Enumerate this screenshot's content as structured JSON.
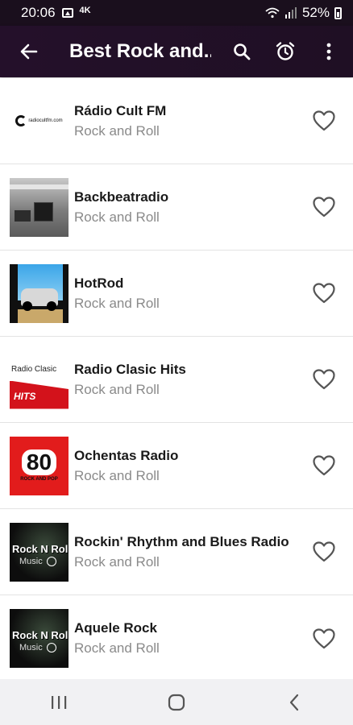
{
  "status_bar": {
    "time": "20:06",
    "battery": "52%",
    "extra": "4K"
  },
  "app_bar": {
    "title": "Best Rock and...",
    "icons": [
      "back-arrow-icon",
      "search-icon",
      "alarm-clock-icon",
      "more-vert-icon"
    ]
  },
  "stations": [
    {
      "name": "Rádio Cult FM",
      "genre": "Rock and Roll",
      "logo_text": "radiocultfm.com"
    },
    {
      "name": "Backbeatradio",
      "genre": "Rock and Roll"
    },
    {
      "name": "HotRod",
      "genre": "Rock and Roll"
    },
    {
      "name": "Radio Clasic Hits",
      "genre": "Rock and Roll",
      "logo_text": "Radio Clasic",
      "logo_badge": "HITS"
    },
    {
      "name": "Ochentas Radio",
      "genre": "Rock and Roll",
      "logo_text": "80",
      "logo_sub": "ROCK AND POP"
    },
    {
      "name": "Rockin' Rhythm and Blues Radio",
      "genre": "Rock and Roll",
      "logo_text": "Rock N Roll",
      "logo_sub": "Music"
    },
    {
      "name": "Aquele Rock",
      "genre": "Rock and Roll",
      "logo_text": "Rock N Roll",
      "logo_sub": "Music"
    }
  ],
  "nav_bar": {
    "icons": [
      "recent-apps-icon",
      "home-icon",
      "back-icon"
    ]
  },
  "colors": {
    "app_bar": "#24102a",
    "genre_text": "#8a8a8a"
  }
}
